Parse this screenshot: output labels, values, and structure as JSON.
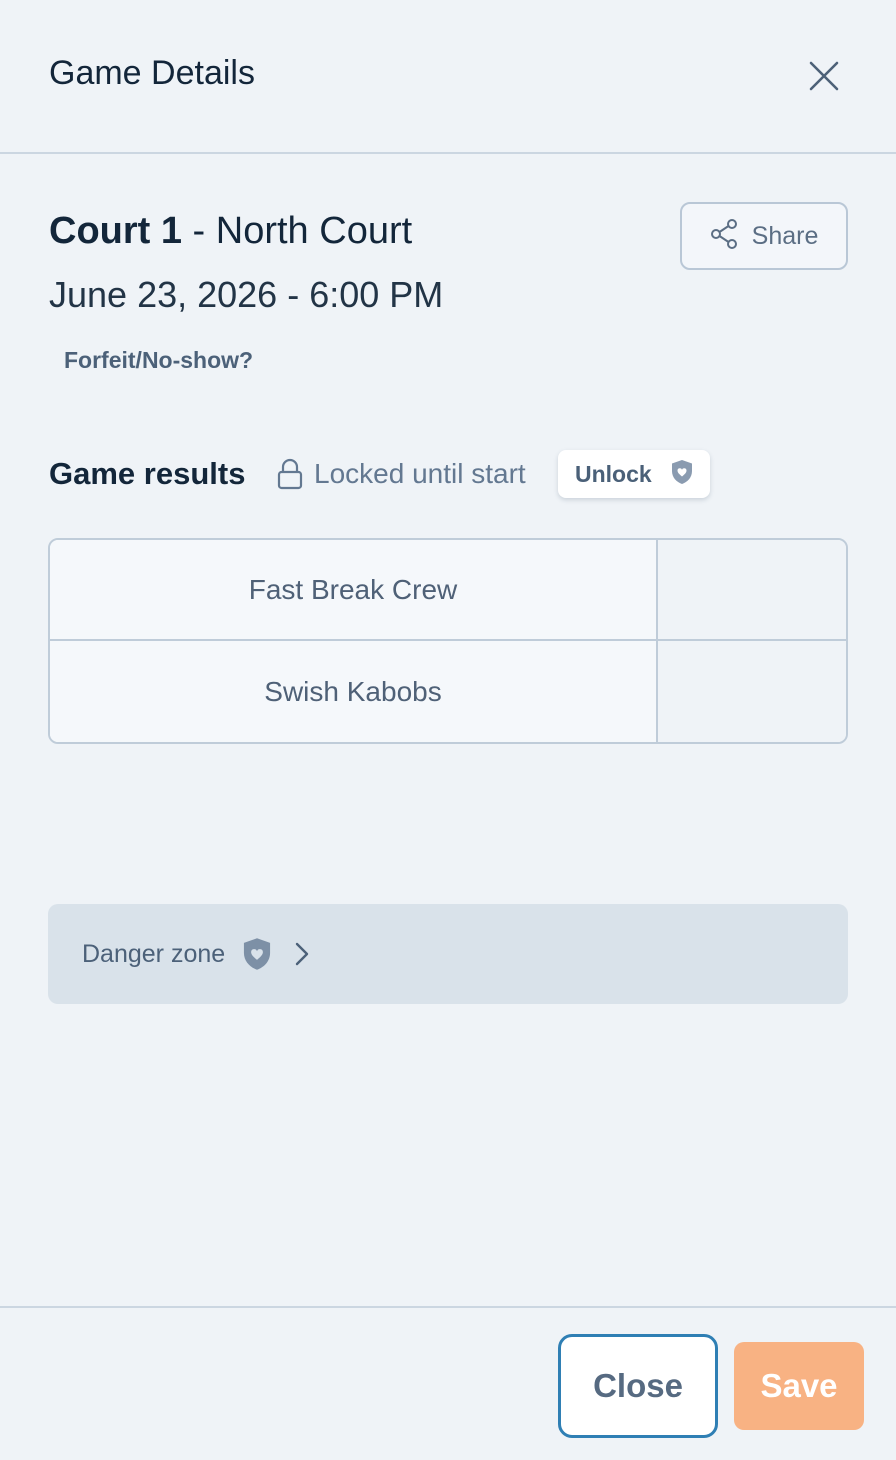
{
  "header": {
    "title": "Game Details"
  },
  "game": {
    "court_name": "Court 1",
    "court_sub": " - North Court",
    "datetime": "June 23, 2026 - 6:00 PM",
    "forfeit_link": "Forfeit/No-show?"
  },
  "share": {
    "label": "Share"
  },
  "results": {
    "title": "Game results",
    "locked_text": "Locked until start",
    "unlock_label": "Unlock",
    "teams": [
      {
        "name": "Fast Break Crew",
        "score": ""
      },
      {
        "name": "Swish Kabobs",
        "score": ""
      }
    ]
  },
  "danger_zone": {
    "label": "Danger zone"
  },
  "footer": {
    "close_label": "Close",
    "save_label": "Save"
  },
  "colors": {
    "background": "#eff3f7",
    "primary_text": "#13263a",
    "save_button": "#f8b283",
    "close_button_border": "#2f7fb4",
    "danger_zone_bg": "#d9e2ea"
  }
}
